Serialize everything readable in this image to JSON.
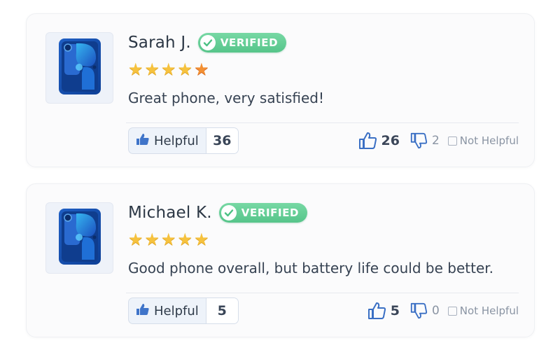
{
  "colors": {
    "verified_badge": "#5ccb8f",
    "star": "#f6c23e",
    "star_accent": "#f39033",
    "thumb_blue": "#3a79d8"
  },
  "reviews": [
    {
      "author": "Sarah J.",
      "badge": "VERIFIED",
      "rating": 5,
      "text": "Great phone, very satisfied!",
      "helpful_label": "Helpful",
      "helpful_count": "36",
      "up_count": "26",
      "down_count": "2",
      "not_helpful_label": "Not Helpful",
      "product_icon": "phone-icon"
    },
    {
      "author": "Michael K.",
      "badge": "VERIFIED",
      "rating": 5,
      "text": "Good phone overall, but battery life could be better.",
      "helpful_label": "Helpful",
      "helpful_count": "5",
      "up_count": "5",
      "down_count": "0",
      "not_helpful_label": "Not Helpful",
      "product_icon": "phone-icon"
    }
  ]
}
